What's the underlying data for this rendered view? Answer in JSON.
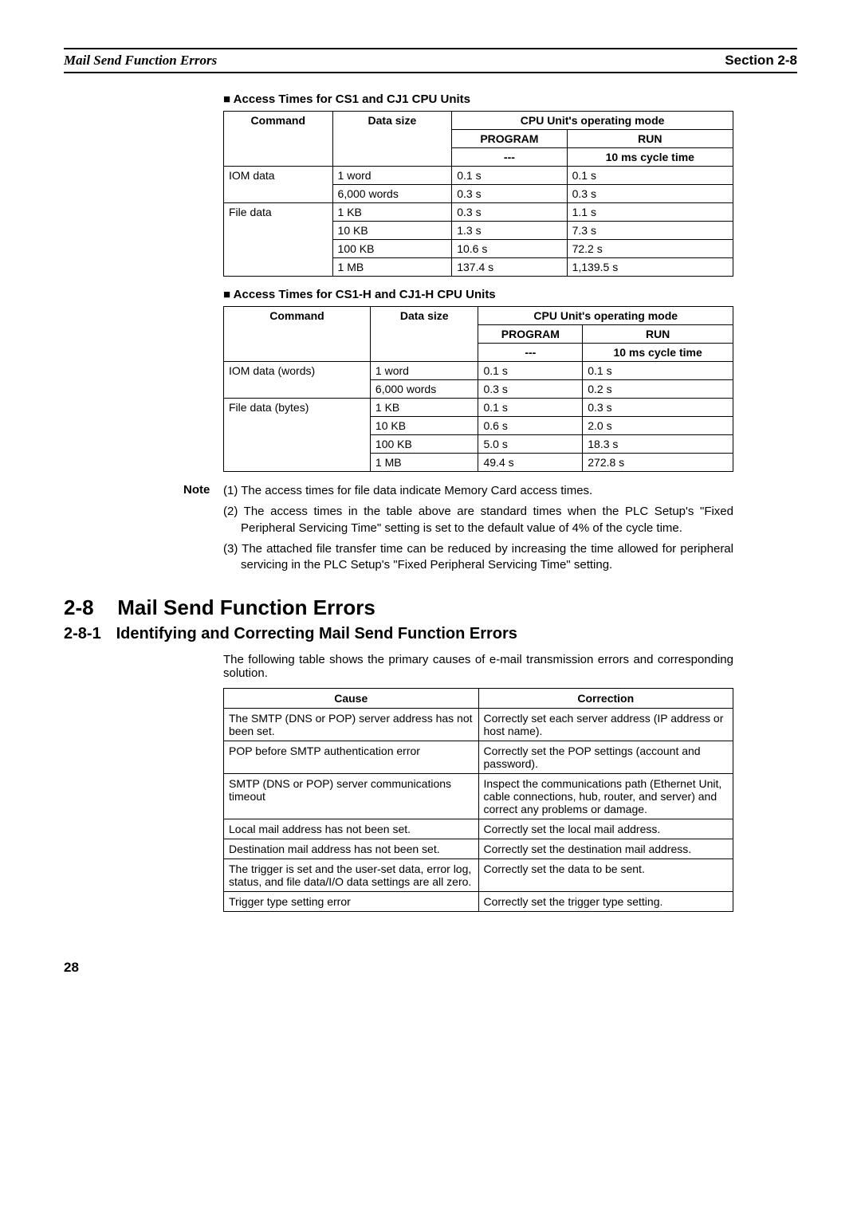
{
  "header": {
    "left": "Mail Send Function Errors",
    "right": "Section 2-8"
  },
  "table1": {
    "title": "Access Times for CS1 and CJ1 CPU Units",
    "headers": {
      "command": "Command",
      "datasize": "Data size",
      "mode": "CPU Unit's operating mode",
      "program": "PROGRAM",
      "run": "RUN",
      "program_sub": "---",
      "run_sub": "10 ms cycle time"
    },
    "rows": [
      {
        "command": "IOM data",
        "size": "1 word",
        "program": "0.1 s",
        "run": "0.1 s"
      },
      {
        "command": "",
        "size": "6,000 words",
        "program": "0.3 s",
        "run": "0.3 s"
      },
      {
        "command": "File data",
        "size": "1 KB",
        "program": "0.3 s",
        "run": "1.1 s"
      },
      {
        "command": "",
        "size": "10 KB",
        "program": "1.3 s",
        "run": "7.3 s"
      },
      {
        "command": "",
        "size": "100 KB",
        "program": "10.6 s",
        "run": "72.2 s"
      },
      {
        "command": "",
        "size": "1 MB",
        "program": "137.4 s",
        "run": "1,139.5 s"
      }
    ]
  },
  "table2": {
    "title": "Access Times for CS1-H and CJ1-H CPU Units",
    "headers": {
      "command": "Command",
      "datasize": "Data size",
      "mode": "CPU Unit's operating mode",
      "program": "PROGRAM",
      "run": "RUN",
      "program_sub": "---",
      "run_sub": "10 ms cycle time"
    },
    "rows": [
      {
        "command": "IOM data (words)",
        "size": "1 word",
        "program": "0.1 s",
        "run": "0.1 s"
      },
      {
        "command": "",
        "size": "6,000 words",
        "program": "0.3 s",
        "run": "0.2 s"
      },
      {
        "command": "File data (bytes)",
        "size": "1 KB",
        "program": "0.1 s",
        "run": "0.3 s"
      },
      {
        "command": "",
        "size": "10 KB",
        "program": "0.6 s",
        "run": "2.0 s"
      },
      {
        "command": "",
        "size": "100 KB",
        "program": "5.0 s",
        "run": "18.3 s"
      },
      {
        "command": "",
        "size": "1 MB",
        "program": "49.4 s",
        "run": "272.8 s"
      }
    ]
  },
  "note": {
    "label": "Note",
    "items": [
      "(1) The access times for file data indicate Memory Card access times.",
      "(2) The access times in the table above are standard times when the PLC Setup's \"Fixed Peripheral Servicing Time\" setting is set to the default value of 4% of the cycle time.",
      "(3) The attached file transfer time can be reduced by increasing the time allowed for peripheral servicing in the PLC Setup's \"Fixed Peripheral Servicing Time\" setting."
    ]
  },
  "section": {
    "num": "2-8",
    "title": "Mail Send Function Errors"
  },
  "subsection": {
    "num": "2-8-1",
    "title": "Identifying and Correcting Mail Send Function Errors",
    "para": "The following table shows the primary causes of e-mail transmission errors and corresponding solution."
  },
  "cause_table": {
    "headers": {
      "cause": "Cause",
      "correction": "Correction"
    },
    "rows": [
      {
        "cause": "The SMTP (DNS or POP) server address has not been set.",
        "correction": "Correctly set each server address (IP address or host name)."
      },
      {
        "cause": "POP before SMTP authentication error",
        "correction": "Correctly set the POP settings (account and password)."
      },
      {
        "cause": "SMTP (DNS or POP) server communications timeout",
        "correction": "Inspect the communications path (Ethernet Unit, cable connections, hub, router, and server) and correct any problems or damage."
      },
      {
        "cause": "Local mail address has not been set.",
        "correction": "Correctly set the local mail address."
      },
      {
        "cause": "Destination mail address has not been set.",
        "correction": "Correctly set the destination mail address."
      },
      {
        "cause": "The trigger is set and the user-set data, error log, status, and file data/I/O data settings are all zero.",
        "correction": "Correctly set the data to be sent."
      },
      {
        "cause": "Trigger type setting error",
        "correction": "Correctly set the trigger type setting."
      }
    ]
  },
  "page_number": "28"
}
